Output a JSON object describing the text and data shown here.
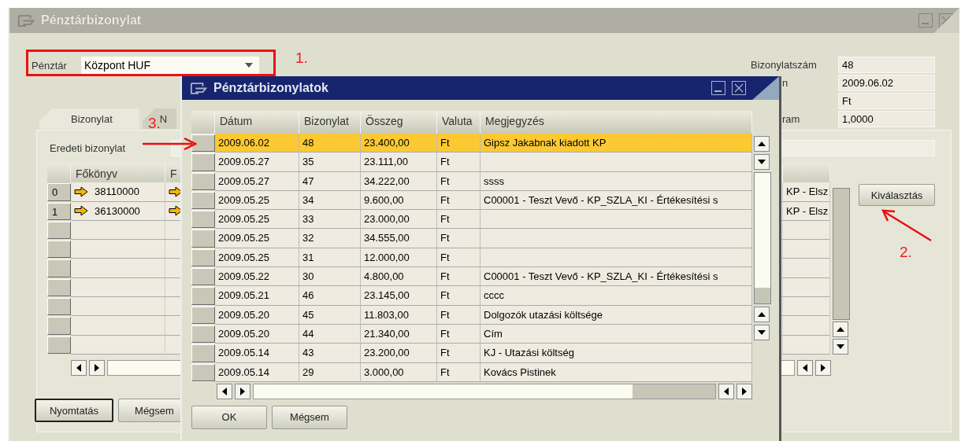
{
  "window": {
    "title": "Pénztárbizonylat"
  },
  "cash_register": {
    "label": "Pénztár",
    "value": "Központ HUF"
  },
  "header_fields": [
    {
      "label": "Bizonylatszám",
      "value": "48"
    },
    {
      "label": "n",
      "value": "2009.06.02"
    },
    {
      "value": "Ft"
    },
    {
      "label": "ram",
      "value": "1,0000"
    }
  ],
  "tabs": [
    {
      "label": "Bizonylat",
      "selected": true
    },
    {
      "label": "N",
      "selected": false
    }
  ],
  "original_document": {
    "label": "Eredeti bizonylat"
  },
  "lines_table": {
    "columns": [
      "Főkönyv",
      "F"
    ],
    "rows": [
      {
        "number": "0",
        "account": "38110000",
        "column_5": "KP - Elsz"
      },
      {
        "number": "1",
        "account": "36130000",
        "column_5": "KP - Elsz"
      }
    ]
  },
  "select_button": "Kiválasztás",
  "buttons": [
    "Nyomtatás",
    "Mégsem"
  ],
  "annotations": [
    "1.",
    "2.",
    "3."
  ],
  "dialog": {
    "title": "Pénztárbizonylatok",
    "columns": [
      "Dátum",
      "Bizonylat",
      "Összeg",
      "Valuta",
      "Megjegyzés"
    ],
    "rows": [
      {
        "date": "2009.06.02",
        "document": "48",
        "amount": "23.400,00",
        "currency": "Ft",
        "note": "Gipsz Jakabnak kiadott KP",
        "selected": true
      },
      {
        "date": "2009.05.27",
        "document": "35",
        "amount": "23.111,00",
        "currency": "Ft",
        "selected": false
      },
      {
        "date": "2009.05.27",
        "document": "47",
        "amount": "34.222,00",
        "currency": "Ft",
        "note": "ssss",
        "selected": false
      },
      {
        "date": "2009.05.25",
        "document": "34",
        "amount": "9.600,00",
        "currency": "Ft",
        "note": "C00001 - Teszt Vevő - KP_SZLA_KI - Értékesítési s",
        "selected": false
      },
      {
        "date": "2009.05.25",
        "document": "33",
        "amount": "23.000,00",
        "currency": "Ft",
        "selected": false
      },
      {
        "date": "2009.05.25",
        "document": "32",
        "amount": "34.555,00",
        "currency": "Ft",
        "selected": false
      },
      {
        "date": "2009.05.25",
        "document": "31",
        "amount": "12.000,00",
        "currency": "Ft",
        "selected": false
      },
      {
        "date": "2009.05.22",
        "document": "30",
        "amount": "4.800,00",
        "currency": "Ft",
        "note": "C00001 - Teszt Vevő - KP_SZLA_KI - Értékesítési s",
        "selected": false
      },
      {
        "date": "2009.05.21",
        "document": "46",
        "amount": "23.145,00",
        "currency": "Ft",
        "note": "cccc",
        "selected": false
      },
      {
        "date": "2009.05.20",
        "document": "45",
        "amount": "11.803,00",
        "currency": "Ft",
        "note": "Dolgozók utazási költsége",
        "selected": false
      },
      {
        "date": "2009.05.20",
        "document": "44",
        "amount": "21.340,00",
        "currency": "Ft",
        "note": "Cím",
        "selected": false
      },
      {
        "date": "2009.05.14",
        "document": "43",
        "amount": "23.200,00",
        "currency": "Ft",
        "note": "KJ - Utazási költség",
        "selected": false
      },
      {
        "date": "2009.05.14",
        "document": "29",
        "amount": "3.000,00",
        "currency": "Ft",
        "note": "Kovács Pistinek",
        "selected": false
      }
    ],
    "buttons": [
      "OK",
      "Mégsem"
    ]
  }
}
